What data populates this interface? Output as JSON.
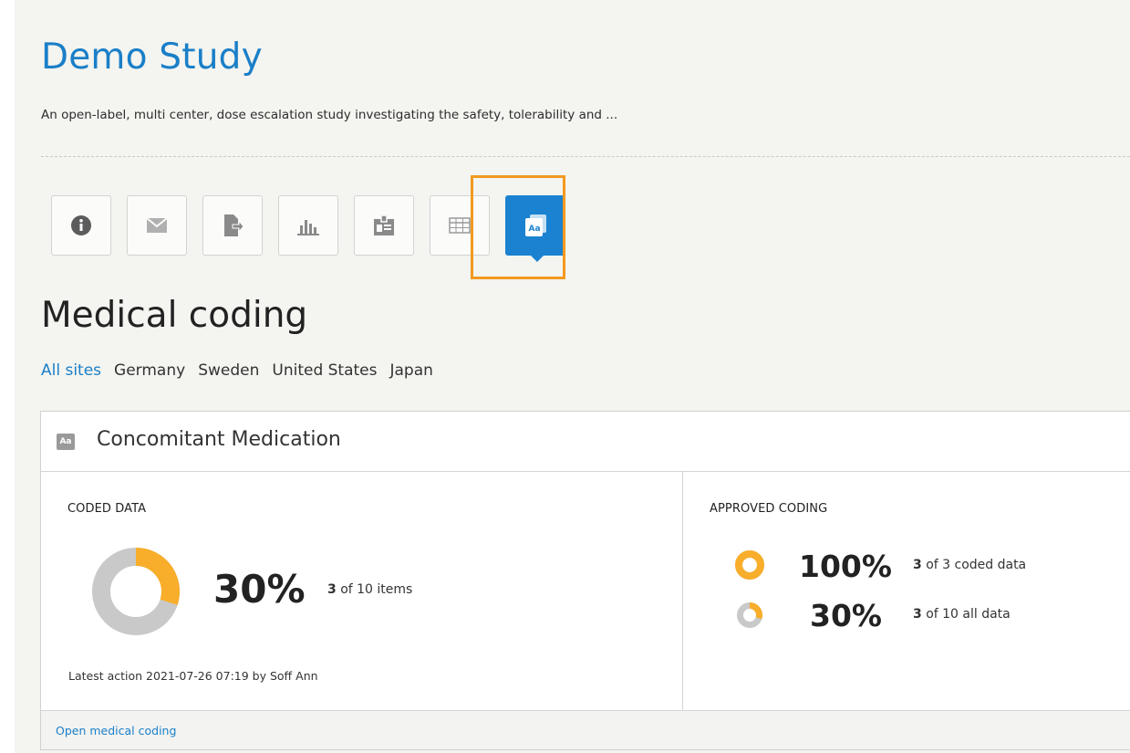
{
  "study": {
    "title": "Demo Study",
    "description": "An open-label, multi center, dose escalation study investigating the safety, tolerability and ..."
  },
  "toolbar": {
    "icons": [
      "info-icon",
      "mail-icon",
      "export-icon",
      "bar-chart-icon",
      "id-card-icon",
      "table-icon",
      "medical-coding-icon"
    ],
    "active_icon": "medical-coding-icon",
    "active_icon_text": "Aa"
  },
  "section": {
    "title": "Medical coding"
  },
  "sites": {
    "items": [
      "All sites",
      "Germany",
      "Sweden",
      "United States",
      "Japan"
    ],
    "selected": "All sites"
  },
  "card": {
    "header_icon_text": "Aa",
    "title": "Concomitant Medication",
    "coded_data": {
      "label": "CODED DATA",
      "percent": "30%",
      "count": "3",
      "count_text": " of 10 items",
      "fraction": 0.3,
      "latest": "Latest action 2021-07-26 07:19 by Soff Ann"
    },
    "approved_coding": {
      "label": "APPROVED CODING",
      "rows": [
        {
          "percent": "100%",
          "count": "3",
          "text": " of 3 coded data",
          "fraction": 1.0
        },
        {
          "percent": "30%",
          "count": "3",
          "text": " of 10 all data",
          "fraction": 0.3
        }
      ]
    },
    "footer_link": "Open medical coding"
  },
  "colors": {
    "accent": "#1a7fc8",
    "highlight": "#f29a1f",
    "donut_fill": "#f8ae2a",
    "donut_track": "#c9c9c9"
  }
}
